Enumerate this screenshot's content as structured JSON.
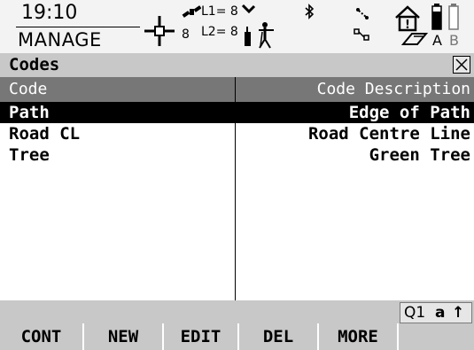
{
  "status": {
    "time": "19:10",
    "mode": "MANAGE",
    "satellites": {
      "l1_label": "L1= 8",
      "l2_label": "L2= 8",
      "visible_count": "8"
    },
    "memory": {
      "device_a": "A",
      "device_b": "B"
    }
  },
  "dialog": {
    "title": "Codes"
  },
  "table": {
    "columns": [
      "Code",
      "Code Description"
    ],
    "rows": [
      {
        "code": "Path",
        "description": "Edge of Path",
        "selected": true
      },
      {
        "code": "Road CL",
        "description": "Road Centre Line",
        "selected": false
      },
      {
        "code": "Tree",
        "description": "Green Tree",
        "selected": false
      }
    ]
  },
  "input_mode": {
    "label": "Q1",
    "case": "a",
    "shift": "↑"
  },
  "softkeys": [
    "CONT",
    "NEW",
    "EDIT",
    "DEL",
    "MORE",
    ""
  ]
}
